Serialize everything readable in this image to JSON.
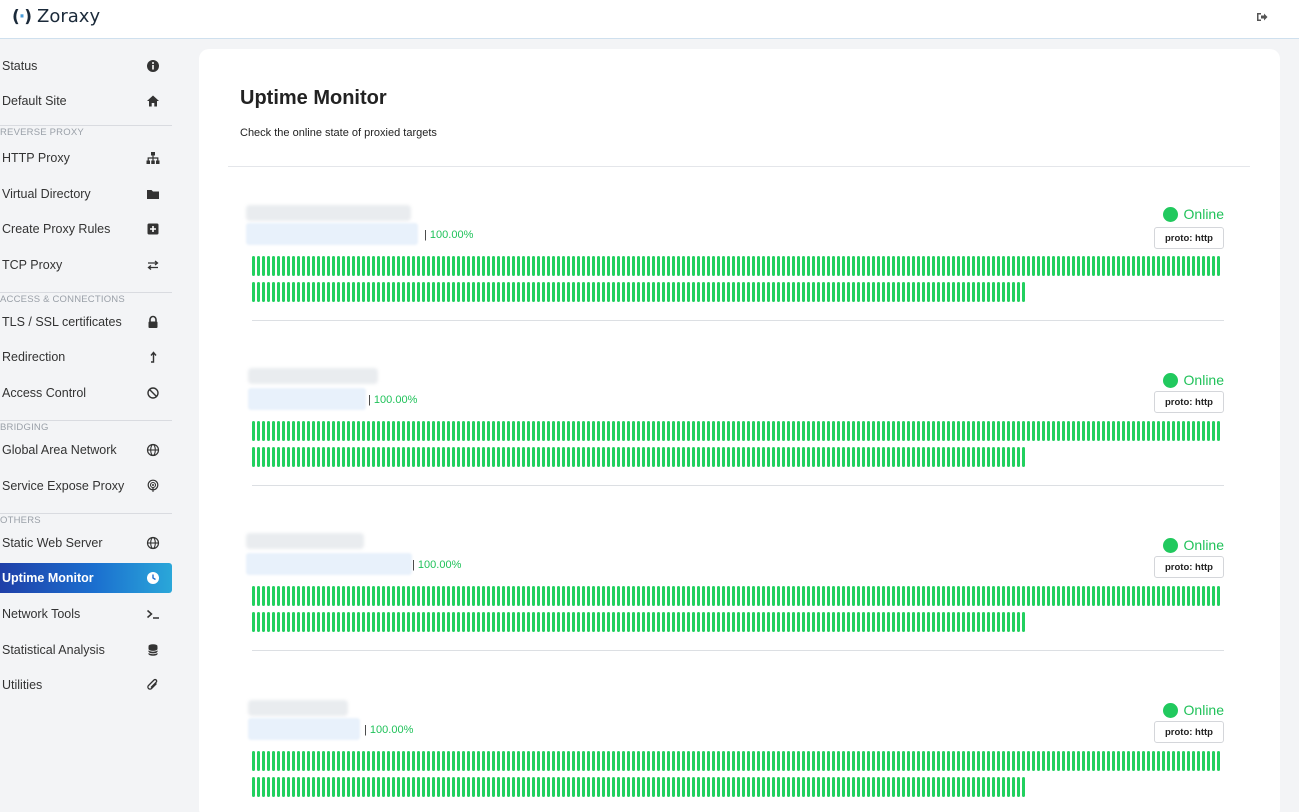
{
  "app": {
    "name": "Zoraxy"
  },
  "sidebar": {
    "items": [
      {
        "label": "Status",
        "icon": "info-circle-icon"
      },
      {
        "label": "Default Site",
        "icon": "home-icon"
      },
      {
        "label": "HTTP Proxy",
        "icon": "sitemap-icon"
      },
      {
        "label": "Virtual Directory",
        "icon": "folder-icon"
      },
      {
        "label": "Create Proxy Rules",
        "icon": "plus-square-icon"
      },
      {
        "label": "TCP Proxy",
        "icon": "exchange-icon"
      },
      {
        "label": "TLS / SSL certificates",
        "icon": "lock-icon"
      },
      {
        "label": "Redirection",
        "icon": "level-up-icon"
      },
      {
        "label": "Access Control",
        "icon": "ban-icon"
      },
      {
        "label": "Global Area Network",
        "icon": "globe-icon"
      },
      {
        "label": "Service Expose Proxy",
        "icon": "podcast-icon"
      },
      {
        "label": "Static Web Server",
        "icon": "globe-icon"
      },
      {
        "label": "Uptime Monitor",
        "icon": "clock-icon"
      },
      {
        "label": "Network Tools",
        "icon": "terminal-icon"
      },
      {
        "label": "Statistical Analysis",
        "icon": "database-icon"
      },
      {
        "label": "Utilities",
        "icon": "paperclip-icon"
      }
    ],
    "sections": {
      "reverse_proxy": "REVERSE PROXY",
      "access": "ACCESS & CONNECTIONS",
      "bridging": "BRIDGING",
      "others": "OTHERS"
    },
    "active": "Uptime Monitor"
  },
  "main": {
    "title": "Uptime Monitor",
    "subtitle": "Check the online state of proxied targets",
    "monitors": [
      {
        "uptime": "100.00%",
        "status": "Online",
        "proto": "proto: http"
      },
      {
        "uptime": "100.00%",
        "status": "Online",
        "proto": "proto: http"
      },
      {
        "uptime": "100.00%",
        "status": "Online",
        "proto": "proto: http"
      },
      {
        "uptime": "100.00%",
        "status": "Online",
        "proto": "proto: http"
      }
    ]
  },
  "colors": {
    "online": "#21c95e",
    "active_gradient_start": "#1f3fa8",
    "active_gradient_end": "#2aa7d9",
    "uptime_text": "#20c25a"
  }
}
